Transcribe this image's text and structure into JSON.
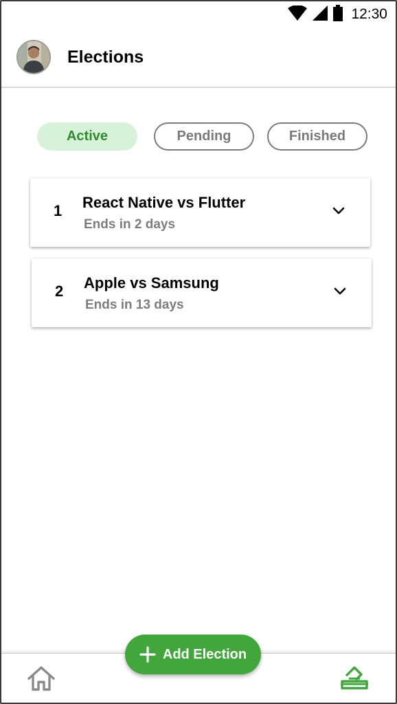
{
  "status_bar": {
    "time": "12:30",
    "icons": [
      "wifi-icon",
      "signal-icon",
      "battery-icon"
    ]
  },
  "header": {
    "title": "Elections",
    "avatar": "profile-photo"
  },
  "tabs": [
    {
      "label": "Active",
      "selected": true
    },
    {
      "label": "Pending",
      "selected": false
    },
    {
      "label": "Finished",
      "selected": false
    }
  ],
  "elections": [
    {
      "index": "1",
      "title": "React Native vs Flutter",
      "subtitle": "Ends in 2 days"
    },
    {
      "index": "2",
      "title": "Apple vs Samsung",
      "subtitle": "Ends in 13 days"
    }
  ],
  "fab": {
    "label": "Add Election",
    "icon": "plus-icon"
  },
  "bottom_nav": {
    "items": [
      {
        "icon": "home-icon",
        "active": false
      },
      {
        "icon": "vote-icon",
        "active": true
      }
    ]
  },
  "colors": {
    "accent": "#43a63d",
    "active_tab_bg": "#d8f2d9",
    "active_tab_text": "#2e8b2e",
    "muted_text": "#7d7d7d"
  }
}
